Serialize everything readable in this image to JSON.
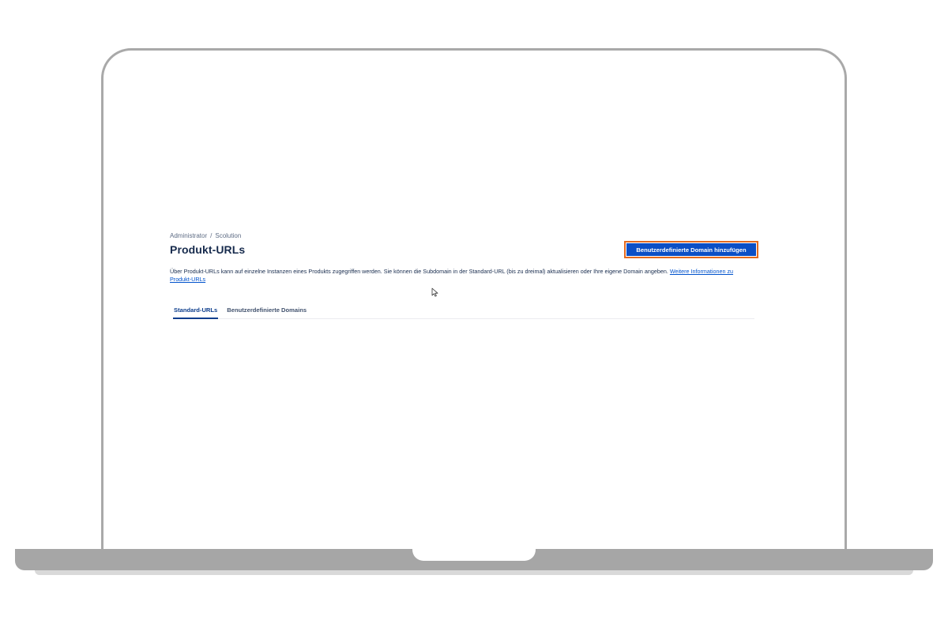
{
  "breadcrumb": {
    "items": [
      "Administrator",
      "Scolution"
    ],
    "separator": "/"
  },
  "page": {
    "title": "Produkt-URLs",
    "description": "Über Produkt-URLs kann auf einzelne Instanzen eines Produkts zugegriffen werden. Sie können die Subdomain in der Standard-URL (bis zu dreimal) aktualisieren oder Ihre eigene Domain angeben.",
    "learn_more_link": "Weitere Informationen zu Produkt-URLs"
  },
  "actions": {
    "add_custom_domain_label": "Benutzerdefinierte Domain hinzufügen"
  },
  "tabs": [
    {
      "label": "Standard-URLs",
      "active": true
    },
    {
      "label": "Benutzerdefinierte Domains",
      "active": false
    }
  ],
  "colors": {
    "button_background": "#0b4fc6",
    "button_highlight_border": "#e36a1f",
    "active_tab": "#0c3d8c",
    "link": "#0052cc",
    "bezel": "#a9a9a9"
  },
  "icons": {
    "cursor": "mouse-pointer-icon"
  }
}
